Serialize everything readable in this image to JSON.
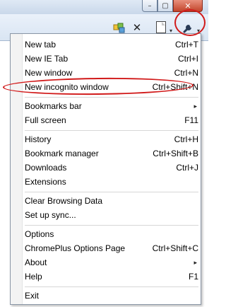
{
  "window_controls": {
    "minimize": "–",
    "maximize": "▢",
    "close": "✕"
  },
  "toolbar": {
    "extension_icon": "extension-icon",
    "stop_icon": "✕",
    "page_icon": "page-icon",
    "wrench_icon": "wrench-icon",
    "dropdown_arrow": "▾"
  },
  "menu": {
    "items": [
      {
        "label": "New tab",
        "shortcut": "Ctrl+T"
      },
      {
        "label": "New IE Tab",
        "shortcut": "Ctrl+I"
      },
      {
        "label": "New window",
        "shortcut": "Ctrl+N"
      },
      {
        "label": "New incognito window",
        "shortcut": "Ctrl+Shift+N"
      },
      {
        "label": "Bookmarks bar",
        "submenu": "▸"
      },
      {
        "label": "Full screen",
        "shortcut": "F11"
      },
      {
        "label": "History",
        "shortcut": "Ctrl+H"
      },
      {
        "label": "Bookmark manager",
        "shortcut": "Ctrl+Shift+B"
      },
      {
        "label": "Downloads",
        "shortcut": "Ctrl+J"
      },
      {
        "label": "Extensions",
        "shortcut": ""
      },
      {
        "label": "Clear Browsing Data",
        "shortcut": ""
      },
      {
        "label": "Set up sync...",
        "shortcut": ""
      },
      {
        "label": "Options",
        "shortcut": ""
      },
      {
        "label": "ChromePlus Options Page",
        "shortcut": "Ctrl+Shift+C"
      },
      {
        "label": "About",
        "submenu": "▸"
      },
      {
        "label": "Help",
        "shortcut": "F1"
      },
      {
        "label": "Exit",
        "shortcut": ""
      }
    ]
  },
  "highlight_color": "#d11a1a"
}
